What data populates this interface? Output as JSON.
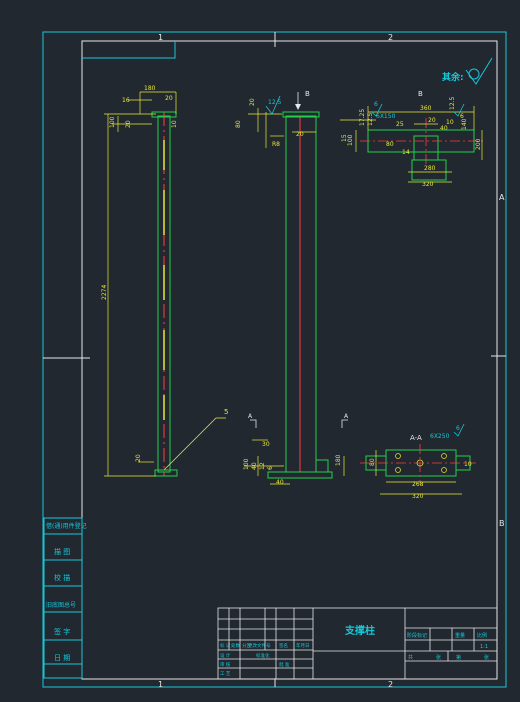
{
  "drawing": {
    "zone_labels": {
      "top_1": "1",
      "top_2": "2",
      "bottom_1": "1",
      "bottom_2": "2",
      "right_a": "A",
      "right_b": "B"
    },
    "finish_note": "其余:",
    "title": "支撑柱",
    "section_label_b": "B",
    "section_view_b_title": "B",
    "section_view_aa_title": "A-A",
    "section_marker_a_left": "A",
    "section_marker_a_right": "A",
    "leader_item_5": "5"
  },
  "left_column_labels": [
    "借(通)用件登记",
    "描 图",
    "校 描",
    "旧底图总号",
    "签 字",
    "日 期"
  ],
  "dimensions": {
    "left_view": [
      "180",
      "20",
      "16",
      "100",
      "20",
      "10",
      "2274",
      "20"
    ],
    "middle_view": [
      "12.5",
      "20",
      "80",
      "R8",
      "20",
      "30",
      "100",
      "40",
      "12",
      "6",
      "40"
    ],
    "view_b": [
      "360",
      "6",
      "6X150",
      "12.5",
      "6",
      "200",
      "280",
      "320",
      "100",
      "15",
      "14",
      "17.25",
      "12.5",
      "140",
      "20",
      "80",
      "40",
      "10",
      "25"
    ],
    "view_aa": [
      "6X250",
      "6",
      "180",
      "80",
      "268",
      "320",
      "10"
    ]
  },
  "title_block": {
    "rows_left": [
      "标 记",
      "设 计",
      "审 核",
      "工 艺",
      "标准化"
    ],
    "cols_left": [
      "处数",
      "分区",
      "更改文件号",
      "签名",
      "年月日"
    ],
    "col_approve": "批 准",
    "right_headers": [
      "阶段标记",
      "重量",
      "比例"
    ],
    "scale": "1:1",
    "sheet_labels": [
      "共",
      "张",
      "第",
      "张"
    ]
  }
}
